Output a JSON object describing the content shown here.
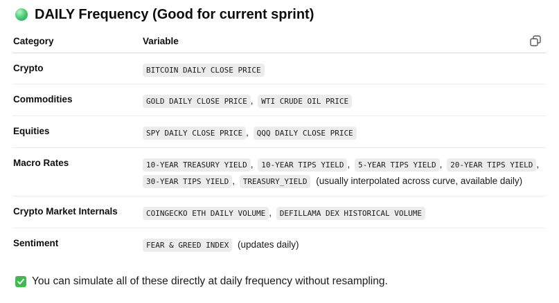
{
  "heading": {
    "icon": "green-orb-icon",
    "text": "DAILY Frequency (Good for current sprint)"
  },
  "table": {
    "headers": [
      "Category",
      "Variable"
    ],
    "rows": [
      {
        "category": "Crypto",
        "variables": [
          "BITCOIN DAILY CLOSE PRICE"
        ],
        "note": ""
      },
      {
        "category": "Commodities",
        "variables": [
          "GOLD DAILY CLOSE PRICE",
          "WTI CRUDE OIL PRICE"
        ],
        "note": ""
      },
      {
        "category": "Equities",
        "variables": [
          "SPY DAILY CLOSE PRICE",
          "QQQ DAILY CLOSE PRICE"
        ],
        "note": ""
      },
      {
        "category": "Macro Rates",
        "variables": [
          "10-YEAR TREASURY YIELD",
          "10-YEAR TIPS YIELD",
          "5-YEAR TIPS YIELD",
          "20-YEAR TIPS YIELD",
          "30-YEAR TIPS YIELD",
          "TREASURY_YIELD"
        ],
        "note": "(usually interpolated across curve, available daily)"
      },
      {
        "category": "Crypto Market Internals",
        "variables": [
          "COINGECKO ETH DAILY VOLUME",
          "DEFILLAMA DEX HISTORICAL VOLUME"
        ],
        "note": ""
      },
      {
        "category": "Sentiment",
        "variables": [
          "FEAR & GREED INDEX"
        ],
        "note": "(updates daily)"
      }
    ]
  },
  "footer": {
    "icon": "check-mark-icon",
    "text": "You can simulate all of these directly at daily frequency without resampling."
  },
  "colors": {
    "code_bg": "#ececec",
    "check_green": "#3fb950",
    "orb_green": "#4fd07a"
  }
}
